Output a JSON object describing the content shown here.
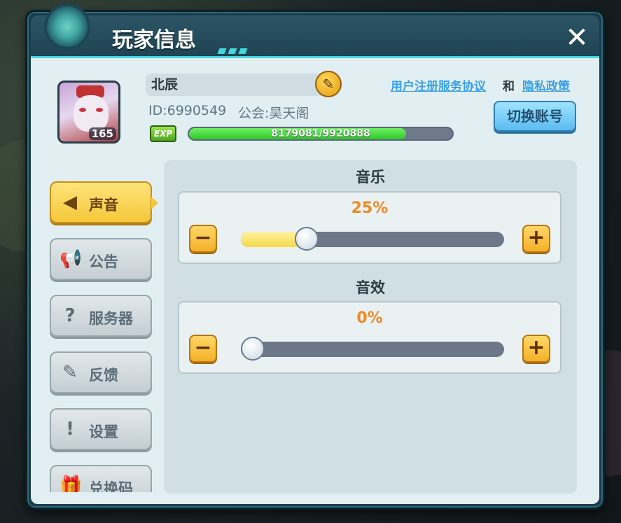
{
  "header": {
    "title": "玩家信息",
    "close_label": "✕"
  },
  "profile": {
    "name": "北辰",
    "level": "165",
    "id_text": "ID:6990549",
    "guild_text": "公会:昊天阁",
    "exp_label": "EXP",
    "exp_text": "8179081/9920888",
    "exp_progress": 0.824,
    "terms_link": "用户注册服务协议",
    "and_text": "和",
    "privacy_link": "隐私政策",
    "switch_account_label": "切换账号"
  },
  "nav": {
    "items": [
      {
        "label": "声音",
        "icon": "speaker-icon",
        "active": true
      },
      {
        "label": "公告",
        "icon": "megaphone-icon",
        "active": false
      },
      {
        "label": "服务器",
        "icon": "server-help-icon",
        "active": false
      },
      {
        "label": "反馈",
        "icon": "edit-note-icon",
        "active": false
      },
      {
        "label": "设置",
        "icon": "exclamation-icon",
        "active": false
      },
      {
        "label": "兑换码",
        "icon": "gift-icon",
        "active": false
      }
    ]
  },
  "sound": {
    "music": {
      "title": "音乐",
      "percent_text": "25%",
      "value": 0.25
    },
    "effects": {
      "title": "音效",
      "percent_text": "0%",
      "value": 0.0
    },
    "minus_label": "−",
    "plus_label": "+"
  },
  "colors": {
    "accent": "#46d5de",
    "percent": "#ef8a22",
    "active_tab": "#f5c73a",
    "link": "#3aa0e6"
  }
}
